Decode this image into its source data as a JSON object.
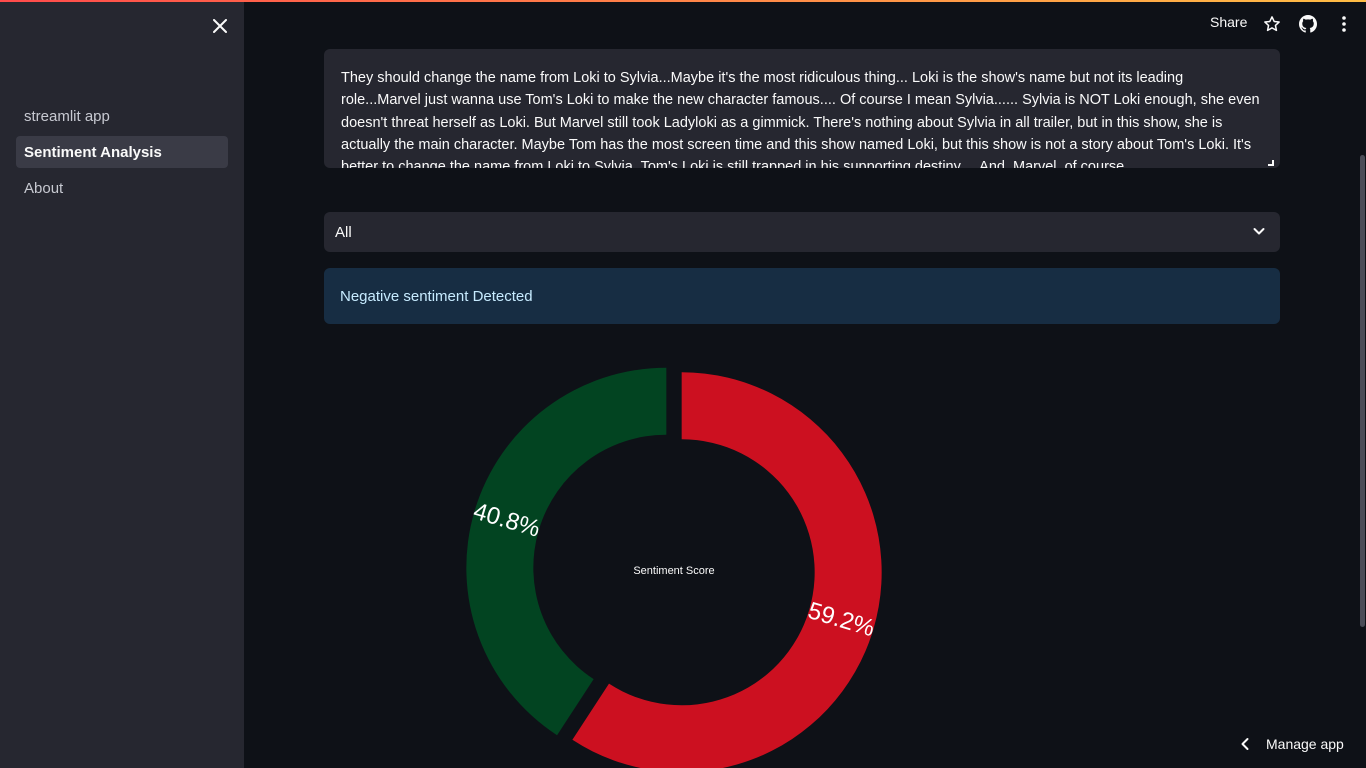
{
  "sidebar": {
    "items": [
      {
        "label": "streamlit app",
        "active": false
      },
      {
        "label": "Sentiment Analysis",
        "active": true
      },
      {
        "label": "About",
        "active": false
      }
    ]
  },
  "header": {
    "share_label": "Share"
  },
  "main": {
    "text_input": "They should change the name from Loki to Sylvia...Maybe it's the most ridiculous thing... Loki is the show's name but not its leading role...Marvel just wanna use Tom's Loki to make the new character famous.... Of course I mean Sylvia...... Sylvia is NOT Loki enough, she even doesn't threat herself as Loki. But Marvel still took Ladyloki as a gimmick. There's nothing about Sylvia in all trailer, but in this show, she is actually the main character. Maybe Tom has the most screen time and this show named Loki, but this show is not a story about Tom's Loki. It's better to change the name from Loki to Sylvia. Tom's Loki is still trapped in his supporting destiny.... And, Marvel, of course",
    "select_value": "All",
    "alert_text": "Negative sentiment Detected"
  },
  "chart_data": {
    "type": "pie",
    "hole": true,
    "center_label": "Sentiment Score",
    "slices": [
      {
        "label": "40.8%",
        "value": 40.8,
        "color": "#024421"
      },
      {
        "label": "59.2%",
        "value": 59.2,
        "color": "#cc1020"
      }
    ]
  },
  "footer": {
    "manage_label": "Manage app"
  }
}
